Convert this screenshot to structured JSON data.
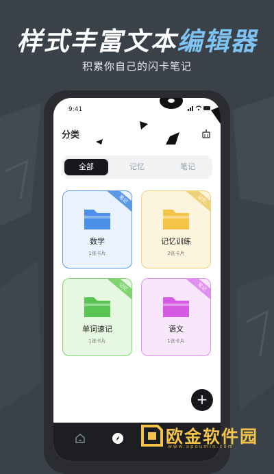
{
  "headline": {
    "part1": "样式丰富文本",
    "part2": "编辑器"
  },
  "subline": "积累你自己的闪卡笔记",
  "status": {
    "time": "9:41"
  },
  "header": {
    "title": "分类"
  },
  "tabs": [
    {
      "label": "全部",
      "active": true
    },
    {
      "label": "记忆",
      "active": false
    },
    {
      "label": "笔记",
      "active": false
    }
  ],
  "cards": [
    {
      "name": "数学",
      "count": "1张卡片",
      "tag": "笔记",
      "color": "#4a8fe8",
      "bg": "#e9f2fd",
      "border": "#5b98e6"
    },
    {
      "name": "记忆训练",
      "count": "2张卡片",
      "tag": "记忆",
      "color": "#f3c445",
      "bg": "#fdf4dd",
      "border": "#efd17a"
    },
    {
      "name": "单词速记",
      "count": "1张卡片",
      "tag": "记忆",
      "color": "#5ac452",
      "bg": "#e6f8e2",
      "border": "#7fd46f"
    },
    {
      "name": "语文",
      "count": "1张卡片",
      "tag": "笔记",
      "color": "#d65ae3",
      "bg": "#f8e6fb",
      "border": "#df8ff0"
    }
  ],
  "fab": {
    "label": "+"
  },
  "watermark": {
    "text": "欧金软件园",
    "url": "www.apoumin.com"
  },
  "colors": {
    "accent": "#7ec3f2",
    "background": "#3b4148",
    "dark": "#16181b"
  }
}
